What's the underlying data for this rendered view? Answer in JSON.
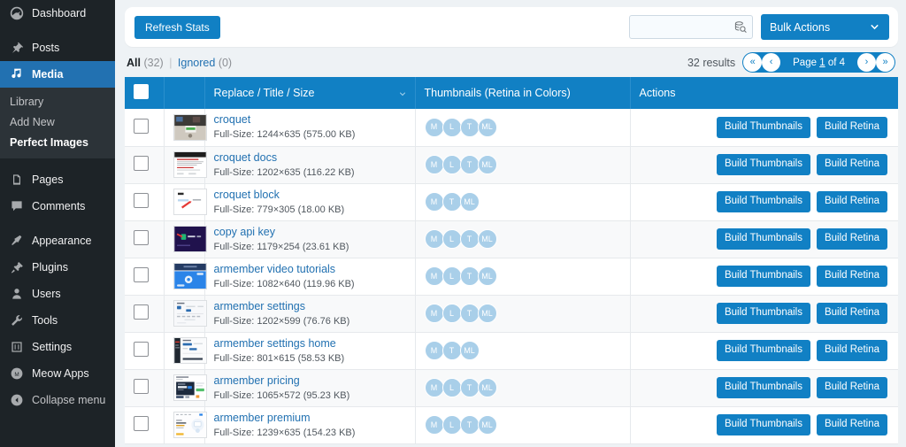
{
  "sidebar": {
    "items": [
      {
        "label": "Dashboard",
        "icon": "dashboard-icon",
        "name": "sidebar-item-dashboard"
      },
      {
        "label": "Posts",
        "icon": "pin-icon",
        "name": "sidebar-item-posts"
      },
      {
        "label": "Media",
        "icon": "media-icon",
        "name": "sidebar-item-media",
        "current": true
      }
    ],
    "submenu": [
      {
        "label": "Library",
        "name": "submenu-item-library",
        "active": false
      },
      {
        "label": "Add New",
        "name": "submenu-item-add-new",
        "active": false
      },
      {
        "label": "Perfect Images",
        "name": "submenu-item-perfect-images",
        "active": true
      }
    ],
    "items2": [
      {
        "label": "Pages",
        "icon": "pages-icon",
        "name": "sidebar-item-pages"
      },
      {
        "label": "Comments",
        "icon": "comments-icon",
        "name": "sidebar-item-comments"
      }
    ],
    "items3": [
      {
        "label": "Appearance",
        "icon": "appearance-icon",
        "name": "sidebar-item-appearance"
      },
      {
        "label": "Plugins",
        "icon": "plugins-icon",
        "name": "sidebar-item-plugins"
      },
      {
        "label": "Users",
        "icon": "users-icon",
        "name": "sidebar-item-users"
      },
      {
        "label": "Tools",
        "icon": "tools-icon",
        "name": "sidebar-item-tools"
      },
      {
        "label": "Settings",
        "icon": "settings-icon",
        "name": "sidebar-item-settings"
      },
      {
        "label": "Meow Apps",
        "icon": "meow-apps-icon",
        "name": "sidebar-item-meow-apps"
      }
    ],
    "collapse": {
      "label": "Collapse menu",
      "icon": "collapse-icon",
      "name": "sidebar-collapse-menu"
    }
  },
  "toolbar": {
    "refresh_label": "Refresh Stats",
    "search_value": "",
    "search_placeholder": "",
    "search_icon": "database-search-icon",
    "bulk_actions_label": "Bulk Actions",
    "bulk_actions_chevron": "chevron-down-icon"
  },
  "filters": {
    "all_label": "All",
    "all_count": "(32)",
    "separator": "|",
    "ignored_label": "Ignored",
    "ignored_count": "(0)"
  },
  "pagination": {
    "results": "32 results",
    "first_glyph": "«",
    "prev_glyph": "‹",
    "page_prefix": "Page",
    "page_current": "1",
    "page_suffix": "of 4",
    "next_glyph": "›",
    "last_glyph": "»",
    "text": "Page 1 of 4"
  },
  "table": {
    "columns": [
      {
        "label": "",
        "name": "column-checkbox"
      },
      {
        "label": "",
        "name": "column-thumbnail"
      },
      {
        "label": "Replace / Title / Size",
        "name": "column-title"
      },
      {
        "label": "Thumbnails (Retina in Colors)",
        "name": "column-thumbnails"
      },
      {
        "label": "Actions",
        "name": "column-actions"
      }
    ],
    "build_thumbnails_label": "Build Thumbnails",
    "build_retina_label": "Build Retina",
    "rows": [
      {
        "title": "croquet",
        "meta": "Full-Size: 1244×635 (575.00 KB)",
        "badges": [
          "M",
          "L",
          "T",
          "ML"
        ],
        "thumb": "photo-desk"
      },
      {
        "title": "croquet docs",
        "meta": "Full-Size: 1202×635 (116.22 KB)",
        "badges": [
          "M",
          "L",
          "T",
          "ML"
        ],
        "thumb": "doc-dark-header"
      },
      {
        "title": "croquet block",
        "meta": "Full-Size: 779×305 (18.00 KB)",
        "badges": [
          "M",
          "T",
          "ML"
        ],
        "thumb": "white-arrow"
      },
      {
        "title": "copy api key",
        "meta": "Full-Size: 1179×254 (23.61 KB)",
        "badges": [
          "M",
          "L",
          "T",
          "ML"
        ],
        "thumb": "dark-terminal"
      },
      {
        "title": "armember video tutorials",
        "meta": "Full-Size: 1082×640 (119.96 KB)",
        "badges": [
          "M",
          "L",
          "T",
          "ML"
        ],
        "thumb": "blue-video"
      },
      {
        "title": "armember settings",
        "meta": "Full-Size: 1202×599 (76.76 KB)",
        "badges": [
          "M",
          "L",
          "T",
          "ML"
        ],
        "thumb": "light-settings"
      },
      {
        "title": "armember settings home",
        "meta": "Full-Size: 801×615 (58.53 KB)",
        "badges": [
          "M",
          "T",
          "ML"
        ],
        "thumb": "sidebar-settings"
      },
      {
        "title": "armember pricing",
        "meta": "Full-Size: 1065×572 (95.23 KB)",
        "badges": [
          "M",
          "L",
          "T",
          "ML"
        ],
        "thumb": "pricing-card"
      },
      {
        "title": "armember premium",
        "meta": "Full-Size: 1239×635 (154.23 KB)",
        "badges": [
          "M",
          "L",
          "T",
          "ML"
        ],
        "thumb": "premium-page"
      }
    ]
  },
  "colors": {
    "accent": "#1180c4",
    "sidebar_bg": "#1d2327",
    "sidebar_current": "#2271b1",
    "badge": "#a9cfe9",
    "link": "#2271b1",
    "page_bg": "#eef2f5"
  }
}
